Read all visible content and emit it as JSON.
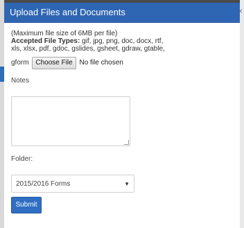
{
  "dialog": {
    "title": "Upload Files and Documents",
    "close_glyph": "×",
    "max_size_note": "(Maximum file size of 6MB per file)",
    "accepted_label": "Accepted File Types:",
    "accepted_types_line1": " gif, jpg, png, doc, docx, rtf,",
    "accepted_types_line2": "xls, xlsx, pdf, gdoc, gslides, gsheet, gdraw, gtable,",
    "file_prefix": "gform",
    "choose_file_label": "Choose File",
    "no_file_text": "No file chosen",
    "notes_label": "Notes",
    "notes_value": "",
    "folder_label": "Folder:",
    "folder_selected": "2015/2016 Forms",
    "submit_label": "Submit"
  },
  "colors": {
    "header": "#2f66b3",
    "submit": "#2f6fc3"
  },
  "icons": {
    "dropdown": "chevron-down-icon",
    "close": "close-icon"
  }
}
